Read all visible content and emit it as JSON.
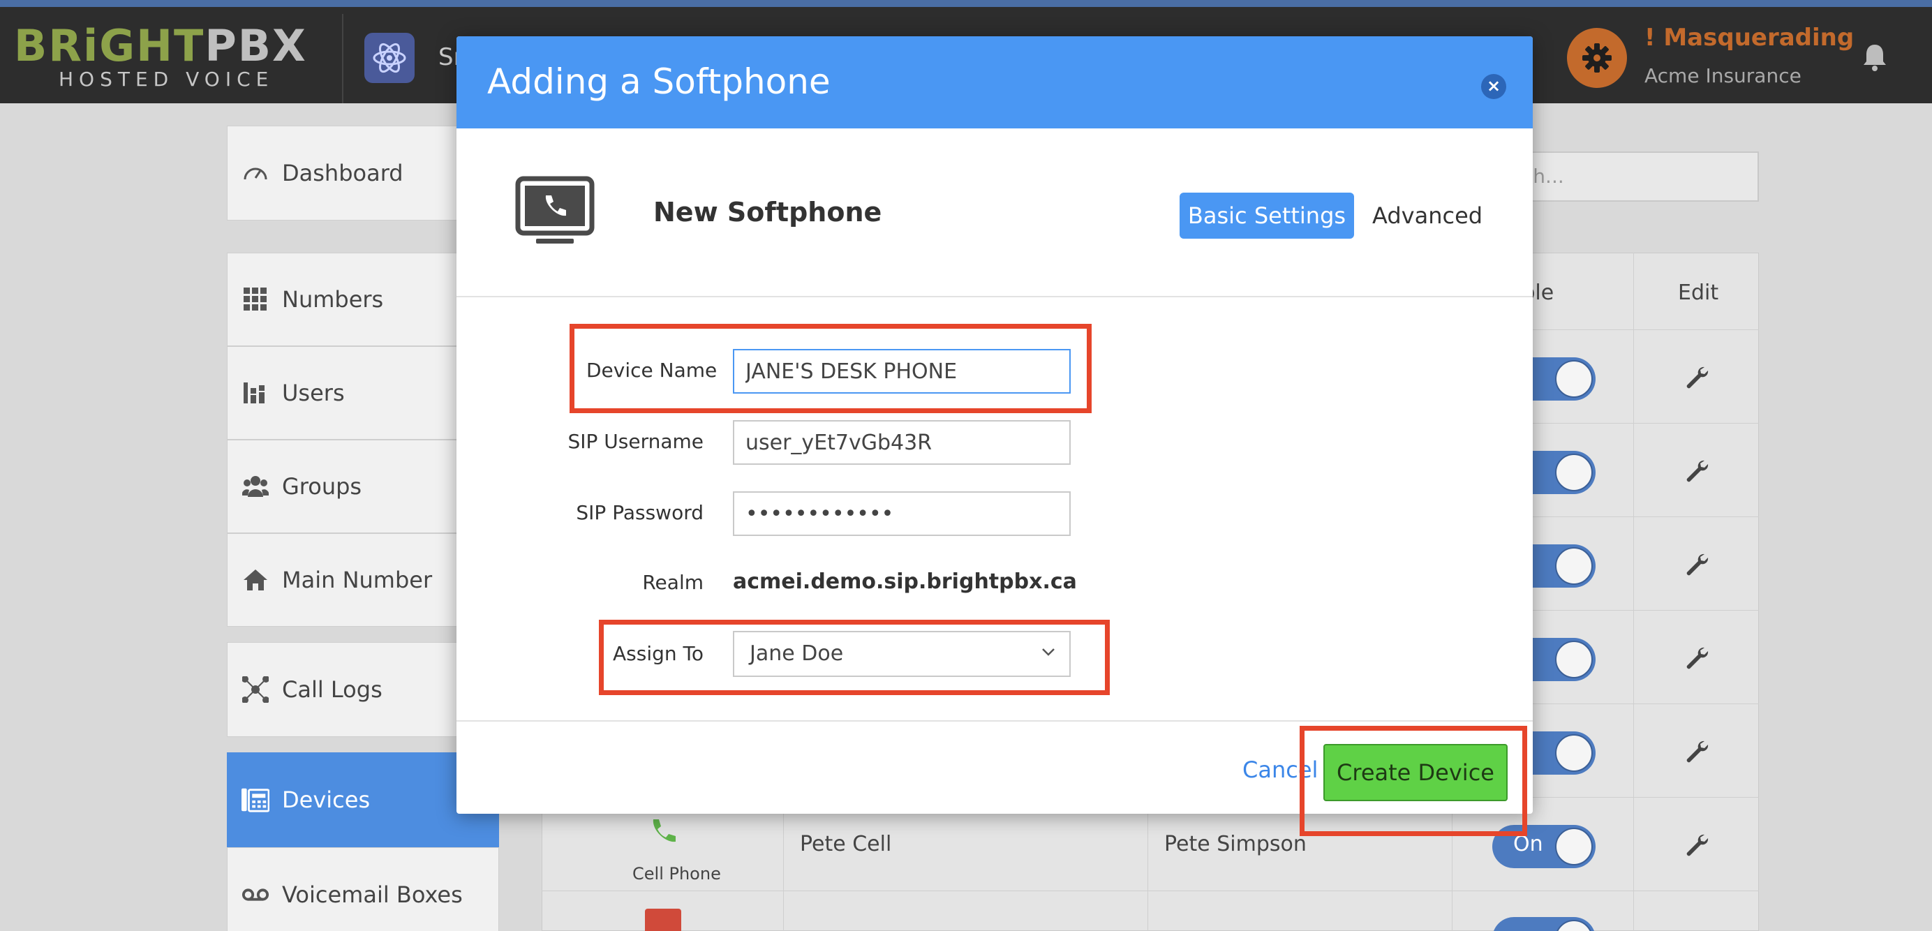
{
  "header": {
    "logo_primary": "BRiGHT",
    "logo_secondary": "PBX",
    "logo_tagline": "HOSTED VOICE",
    "app_label": "Sr",
    "masquerade_title": "! Masquerading",
    "masquerade_org": "Acme Insurance"
  },
  "sidebar": {
    "items": [
      {
        "label": "Dashboard",
        "icon": "gauge-icon"
      },
      {
        "label": "Numbers",
        "icon": "grid-icon"
      },
      {
        "label": "Users",
        "icon": "users-icon"
      },
      {
        "label": "Groups",
        "icon": "group-icon"
      },
      {
        "label": "Main Number",
        "icon": "home-icon"
      },
      {
        "label": "Call Logs",
        "icon": "network-icon"
      },
      {
        "label": "Devices",
        "icon": "phone-icon"
      },
      {
        "label": "Voicemail Boxes",
        "icon": "voicemail-icon"
      }
    ]
  },
  "background": {
    "search_placeholder": "rch...",
    "col_enable": "able",
    "col_edit": "Edit",
    "toggle_label": "n",
    "toggle_label_full": "On",
    "last_row": {
      "type": "Cell Phone",
      "name": "Pete Cell",
      "user": "Pete Simpson"
    }
  },
  "modal": {
    "title": "Adding a Softphone",
    "close_label": "×",
    "device_title": "New Softphone",
    "tab_basic": "Basic Settings",
    "tab_advanced": "Advanced",
    "fields": {
      "device_name_label": "Device Name",
      "device_name_value": "JANE'S DESK PHONE",
      "sip_username_label": "SIP Username",
      "sip_username_value": "user_yEt7vGb43R",
      "sip_password_label": "SIP Password",
      "sip_password_value": "••••••••••••",
      "realm_label": "Realm",
      "realm_value": "acmei.demo.sip.brightpbx.ca",
      "assign_to_label": "Assign To",
      "assign_to_value": "Jane Doe"
    },
    "cancel_label": "Cancel",
    "create_label": "Create Device"
  },
  "colors": {
    "modal_header": "#4a97f3",
    "create_button": "#5fd146",
    "annotation": "#e6452b",
    "sidebar_active": "#4d8de0"
  }
}
